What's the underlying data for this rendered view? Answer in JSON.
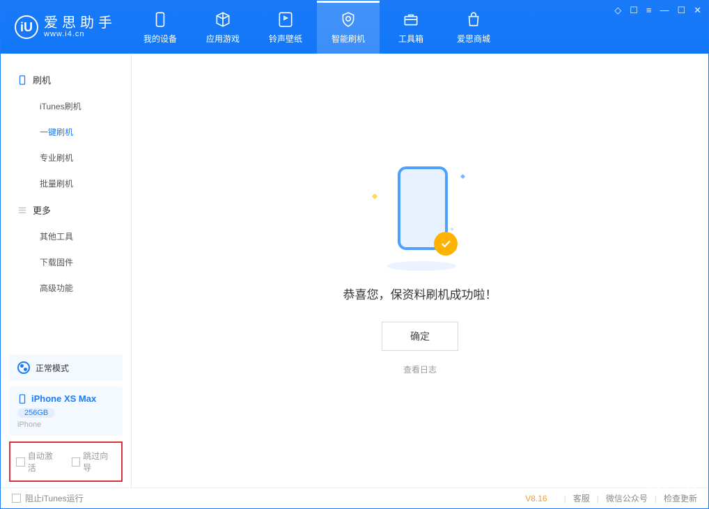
{
  "app": {
    "name_cn": "爱思助手",
    "name_en": "www.i4.cn",
    "logo_letter": "iU"
  },
  "header_tabs": [
    {
      "label": "我的设备",
      "icon": "device"
    },
    {
      "label": "应用游戏",
      "icon": "cube"
    },
    {
      "label": "铃声壁纸",
      "icon": "music"
    },
    {
      "label": "智能刷机",
      "icon": "shield",
      "active": true
    },
    {
      "label": "工具箱",
      "icon": "toolbox"
    },
    {
      "label": "爱思商城",
      "icon": "bag"
    }
  ],
  "sidebar": {
    "group1": {
      "title": "刷机",
      "items": [
        "iTunes刷机",
        "一键刷机",
        "专业刷机",
        "批量刷机"
      ],
      "active_index": 1
    },
    "group2": {
      "title": "更多",
      "items": [
        "其他工具",
        "下载固件",
        "高级功能"
      ]
    }
  },
  "mode": {
    "label": "正常模式"
  },
  "device": {
    "name": "iPhone XS Max",
    "storage": "256GB",
    "type": "iPhone"
  },
  "options": {
    "auto_activate": "自动激活",
    "skip_guide": "跳过向导"
  },
  "result": {
    "message": "恭喜您，保资料刷机成功啦！",
    "ok": "确定",
    "view_log": "查看日志"
  },
  "status": {
    "block_itunes": "阻止iTunes运行",
    "version": "V8.16",
    "links": [
      "客服",
      "微信公众号",
      "检查更新"
    ]
  }
}
